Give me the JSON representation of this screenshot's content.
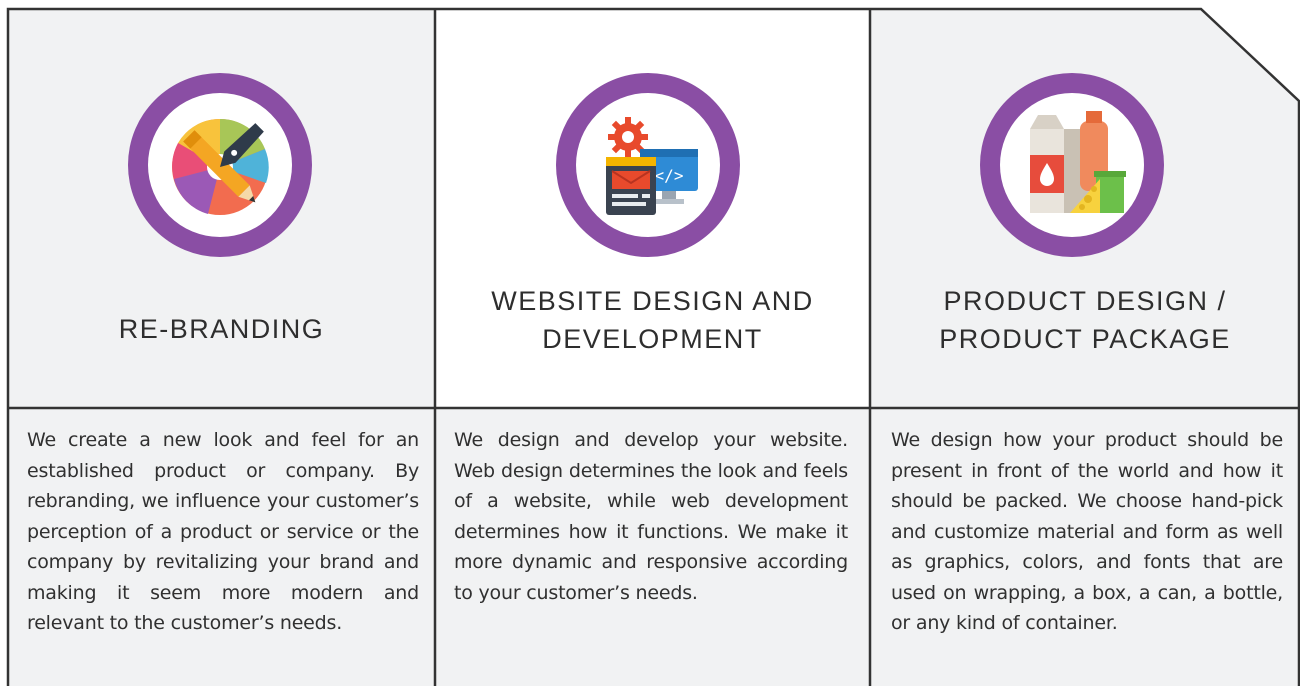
{
  "services": [
    {
      "title_lines": [
        "RE-BRANDING"
      ],
      "icon": "pen-color-wheel-icon",
      "description": "We create a new look and feel for an established product or company. By rebranding, we influence your customer’s perception of a product or service or the company by revitalizing your brand and making it seem more modern and relevant to the customer’s needs."
    },
    {
      "title_lines": [
        "WEBSITE DESIGN AND",
        "DEVELOPMENT"
      ],
      "icon": "web-development-icon",
      "description": "We design and develop your website. Web design determines the look and feels of a website, while web development determines how it functions. We make it more dynamic and responsive according to your customer’s needs."
    },
    {
      "title_lines": [
        "PRODUCT DESIGN /",
        "PRODUCT PACKAGE"
      ],
      "icon": "product-packaging-icon",
      "description": "We design how your product should be present in front of the world and how it should be packed.  We choose hand-pick and customize material and form as well as graphics, colors, and fonts that are used on wrapping, a box, a can, a bottle, or any kind of container."
    }
  ],
  "colors": {
    "accent_ring": "#8a4ea4",
    "border": "#333333",
    "panel_bg": "#f1f2f3"
  }
}
